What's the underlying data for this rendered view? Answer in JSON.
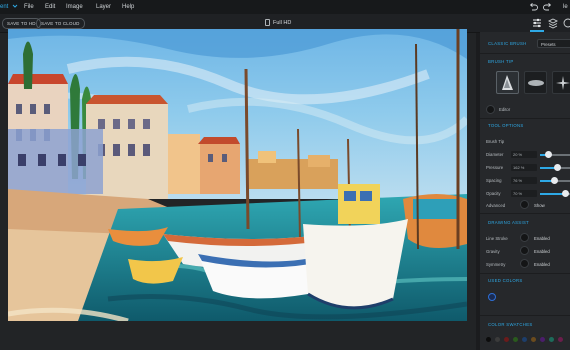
{
  "menubar": {
    "app_name": "ent",
    "items": [
      "File",
      "Edit",
      "Image",
      "Layer",
      "Help"
    ],
    "user_initial": "le"
  },
  "toolbar": {
    "save_hd": "SAVE TO HD",
    "save_cloud": "SAVE TO CLOUD",
    "doc_title": "Full HD"
  },
  "panel": {
    "classic_brush": "CLASSIC BRUSH",
    "presets": "Presets",
    "brush_tip": "BRUSH TIP",
    "editor": "Editor",
    "tool_options": "TOOL OPTIONS",
    "brush_tip_label": "Brush Tip",
    "options": [
      {
        "label": "Diameter",
        "value": "20",
        "fraction": 0.25
      },
      {
        "label": "Pressure",
        "value": "162",
        "fraction": 0.55
      },
      {
        "label": "Spacing",
        "value": "76",
        "fraction": 0.45
      },
      {
        "label": "Opacity",
        "value": "70",
        "fraction": 0.82
      }
    ],
    "advanced": "Advanced",
    "show": "Show",
    "drawing_assist": "DRAWING ASSIST",
    "assists": [
      {
        "label": "Line Stroke",
        "state": "Enabled"
      },
      {
        "label": "Gravity",
        "state": "Enabled"
      },
      {
        "label": "Symmetry",
        "state": "Enabled"
      }
    ],
    "used_colors": "USED COLORS",
    "color_swatches": "COLOR SWATCHES"
  },
  "colors": {
    "accent": "#2ea9e6",
    "used_color": "#2e6fd6",
    "swatches": [
      "#0c0c0c",
      "#3b3b3b",
      "#6b1b1b",
      "#2a5a1d",
      "#1d3e6b",
      "#6b4b1d",
      "#4b1d6b",
      "#1d6b5a",
      "#6b1d4b"
    ]
  }
}
